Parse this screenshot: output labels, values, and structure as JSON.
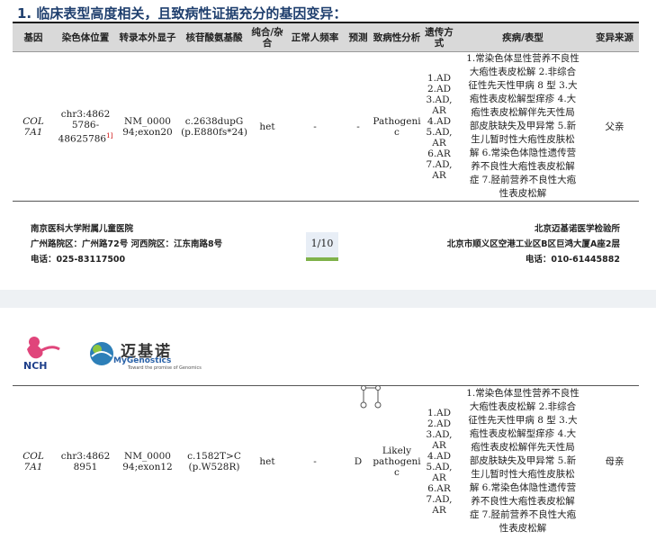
{
  "title": "1.  临床表型高度相关，且致病性证据充分的基因变异：",
  "headers": [
    "基因",
    "染色体位置",
    "转录本外显子",
    "核苷酸氨基酸",
    "纯合/杂合",
    "正常人频率",
    "预测",
    "致病性分析",
    "遗传方式",
    "疾病/表型",
    "变异来源"
  ],
  "row1": {
    "gene": "COL 7A1",
    "chrom": "chr3:4862 5786-48625786",
    "chrom_ref": "1]",
    "transcript": "NM_0000 94;exon20",
    "nucleotide": "c.2638dupG (p.E880fs*24)",
    "zygosity": "het",
    "freq": "-",
    "predict": "-",
    "pathogenic": "Pathogeni c",
    "inheritance": [
      "1.AD",
      "2.AD",
      "3.AD,",
      "AR",
      "4.AD",
      "5.AD,",
      "AR",
      "6.AR",
      "7.AD,",
      "AR"
    ],
    "disease": [
      "1.常染色体显性营养不良性",
      "大疱性表皮松解 2.非综合",
      "征性先天性甲病 8 型 3.大",
      "疱性表皮松解型痒疹 4.大",
      "疱性表皮松解伴先天性局",
      "部皮肤缺失及甲异常 5.新",
      "生儿暂时性大疱性皮肤松",
      "解 6.常染色体隐性遗传营",
      "养不良性大疱性表皮松解",
      "症 7.胫前营养不良性大疱",
      "性表皮松解"
    ],
    "origin": "父亲"
  },
  "footer": {
    "left": [
      "南京医科大学附属儿童医院",
      "广州路院区：广州路72号    河西院区：江东南路8号",
      "电话：025-83117500"
    ],
    "page": "1/10",
    "right": [
      "北京迈基诺医学检验所",
      "北京市顺义区空港工业区B区巨鸿大厦A座2层",
      "电话：010-61445882"
    ]
  },
  "logos": {
    "nch": "NCH",
    "mygen_cn": "迈基诺",
    "mygen_en": "MyGenostics",
    "mygen_sub": "Toward the promise of Genomics"
  },
  "row2": {
    "gene": "COL 7A1",
    "chrom": "chr3:4862 8951",
    "transcript": "NM_0000 94;exon12",
    "nucleotide": "c.1582T>C (p.W528R)",
    "zygosity": "het",
    "freq": "-",
    "predict": "D",
    "pathogenic": "Likely pathogeni c",
    "inheritance": [
      "1.AD",
      "2.AD",
      "3.AD,",
      "AR",
      "4.AD",
      "5.AD,",
      "AR",
      "6.AR",
      "7.AD,",
      "AR"
    ],
    "disease": [
      "1.常染色体显性营养不良性",
      "大疱性表皮松解 2.非综合",
      "征性先天性甲病 8 型 3.大",
      "疱性表皮松解型痒疹 4.大",
      "疱性表皮松解伴先天性局",
      "部皮肤缺失及甲异常 5.新",
      "生儿暂时性大疱性皮肤松",
      "解 6.常染色体隐性遗传营",
      "养不良性大疱性表皮松解",
      "症 7.胫前营养不良性大疱",
      "性表皮松解"
    ],
    "origin": "母亲"
  }
}
